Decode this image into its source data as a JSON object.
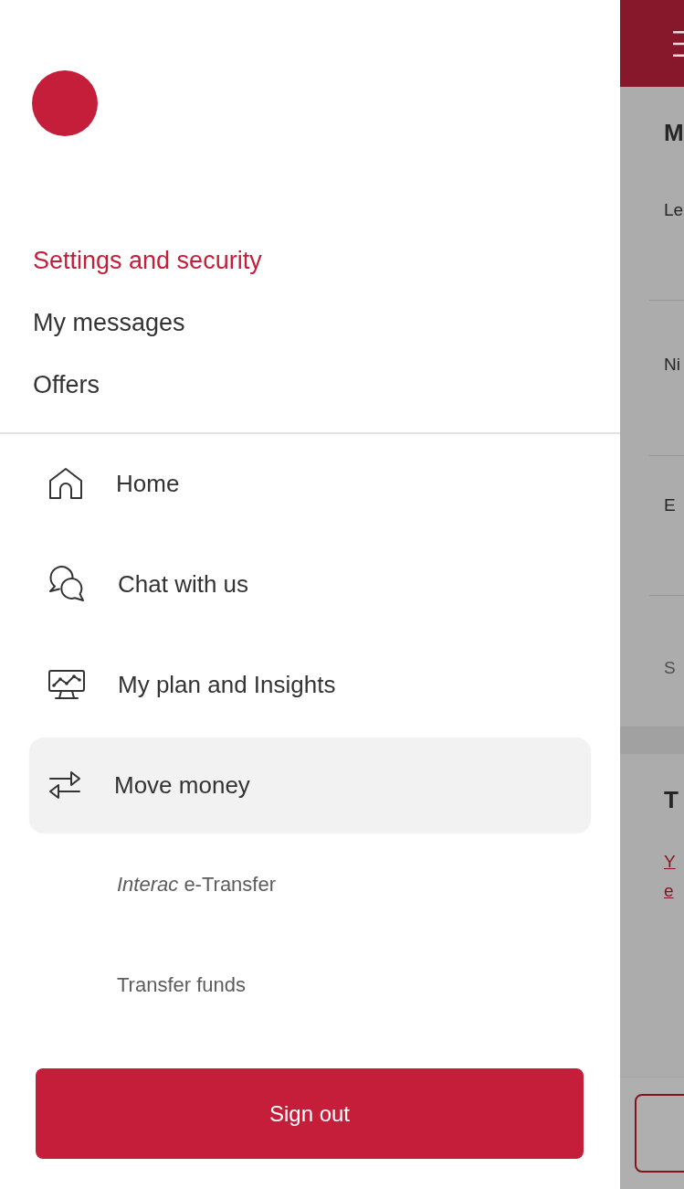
{
  "drawer": {
    "profile_links": [
      {
        "label": "Settings and security",
        "selected": true
      },
      {
        "label": "My messages",
        "selected": false
      },
      {
        "label": "Offers",
        "selected": false
      }
    ],
    "nav_items": [
      {
        "kind": "home",
        "label": "Home",
        "selected": false
      },
      {
        "kind": "chat",
        "label": "Chat with us",
        "selected": false
      },
      {
        "kind": "plan",
        "label": "My plan and Insights",
        "selected": false
      },
      {
        "kind": "transfer",
        "label": "Move money",
        "selected": true,
        "children": [
          {
            "label": "*Interac* e-Transfer"
          },
          {
            "label": "Transfer funds"
          }
        ]
      }
    ],
    "sign_out_button": "Sign out"
  },
  "background_page": {
    "sections": [
      {
        "title": "M",
        "fields": [
          "Le",
          "Ni",
          "E"
        ],
        "note": "S"
      },
      {
        "title": "T",
        "link_lines": [
          "Y",
          "e"
        ]
      }
    ]
  }
}
